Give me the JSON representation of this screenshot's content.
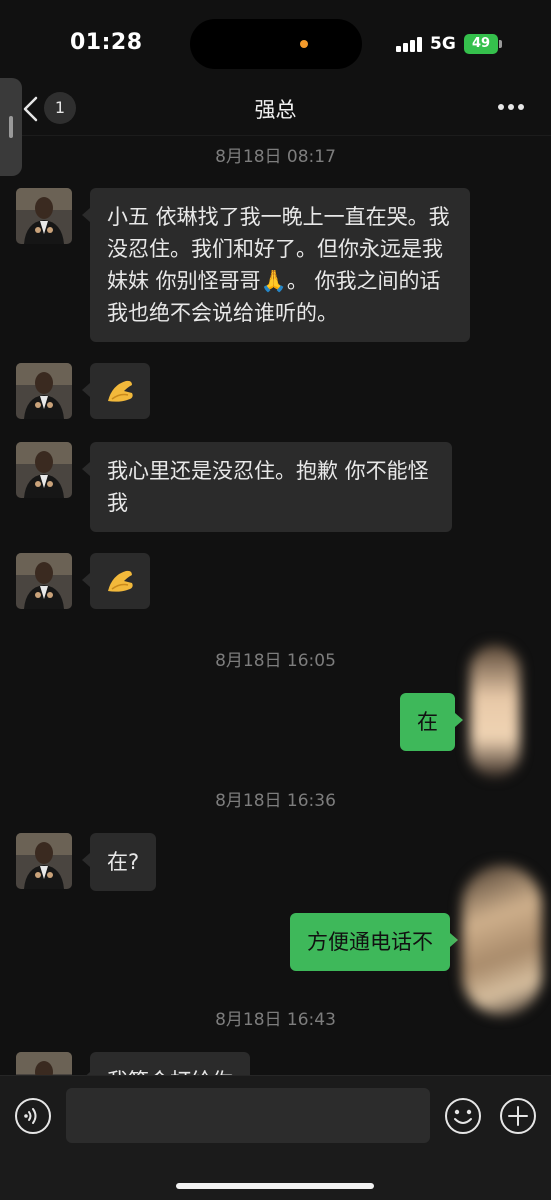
{
  "status_bar": {
    "time": "01:28",
    "network": "5G",
    "battery": "49"
  },
  "nav": {
    "unread_count": "1",
    "title": "强总"
  },
  "messages": [
    {
      "type": "timestamp",
      "text": "8月18日 08:17"
    },
    {
      "type": "incoming",
      "text": "小五 依琳找了我一晚上一直在哭。我没忍住。我们和好了。但你永远是我妹妹 你别怪哥哥🙏。 你我之间的话我也绝不会说给谁听的。"
    },
    {
      "type": "incoming-emoji",
      "emoji": "pinched-fingers-icon"
    },
    {
      "type": "incoming",
      "text": "我心里还是没忍住。抱歉 你不能怪我"
    },
    {
      "type": "incoming-emoji",
      "emoji": "pinched-fingers-icon"
    },
    {
      "type": "timestamp",
      "text": "8月18日 16:05"
    },
    {
      "type": "outgoing",
      "text": "在"
    },
    {
      "type": "timestamp",
      "text": "8月18日 16:36"
    },
    {
      "type": "incoming",
      "text": "在?"
    },
    {
      "type": "outgoing",
      "text": "方便通电话不"
    },
    {
      "type": "timestamp",
      "text": "8月18日 16:43"
    },
    {
      "type": "incoming",
      "text": "我等会打给你"
    }
  ],
  "colors": {
    "outgoing_bubble": "#3eb85a",
    "incoming_bubble": "#2b2b2b",
    "background": "#111111"
  },
  "input": {
    "placeholder": ""
  }
}
